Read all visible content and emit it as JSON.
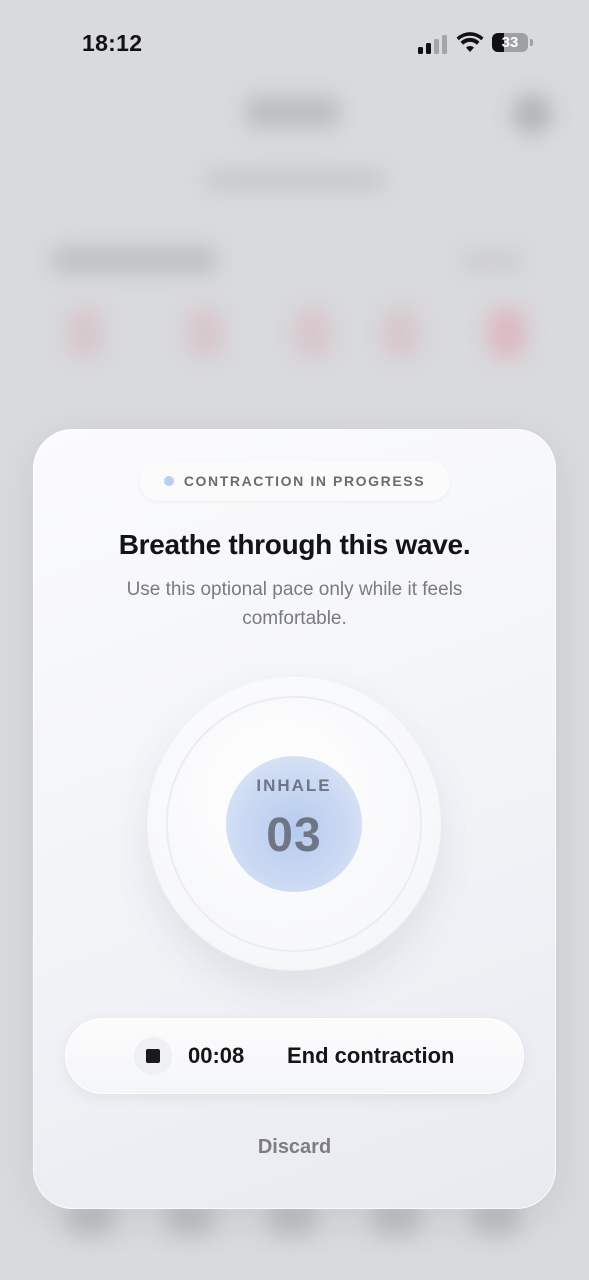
{
  "status_bar": {
    "time": "18:12",
    "battery_level": "33",
    "signal_bars_filled": 2,
    "signal_bars_total": 4
  },
  "modal": {
    "badge": "CONTRACTION IN PROGRESS",
    "title": "Breathe through this wave.",
    "subtitle": "Use this optional pace only while it feels comfortable.",
    "breathing": {
      "phase": "INHALE",
      "count": "03"
    },
    "action": {
      "elapsed": "00:08",
      "label": "End contraction"
    },
    "discard_label": "Discard"
  },
  "colors": {
    "accent_blue": "#b7cbef",
    "badge_dot": "#b8d0f0",
    "text_primary": "#141416",
    "text_secondary": "#7a7a80"
  },
  "icons": {
    "stop": "stop-icon",
    "signal": "cellular-signal-icon",
    "wifi": "wifi-icon",
    "battery": "battery-icon"
  }
}
